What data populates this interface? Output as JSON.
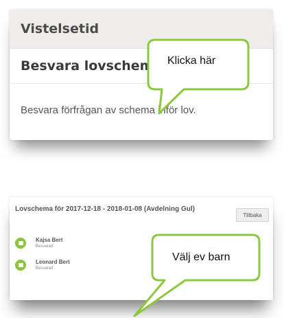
{
  "top_card": {
    "header": "Vistelsetid",
    "subheader": "Besvara lovschema",
    "description": "Besvara förfrågan av schema inför lov."
  },
  "callout_top": {
    "text": "Klicka här"
  },
  "bottom_card": {
    "title": "Lovschema för 2017-12-18 - 2018-01-08 (Avdelning Gul)",
    "back_button": "Tillbaka",
    "children": [
      {
        "name": "Kajsa Bert",
        "status": "Besvarad"
      },
      {
        "name": "Leonard Bert",
        "status": "Besvarad"
      }
    ]
  },
  "callout_bottom": {
    "text": "Välj ev barn"
  },
  "colors": {
    "accent_green": "#8cc63f",
    "callout_border": "#8dc63f",
    "header_bg": "#efede9"
  }
}
